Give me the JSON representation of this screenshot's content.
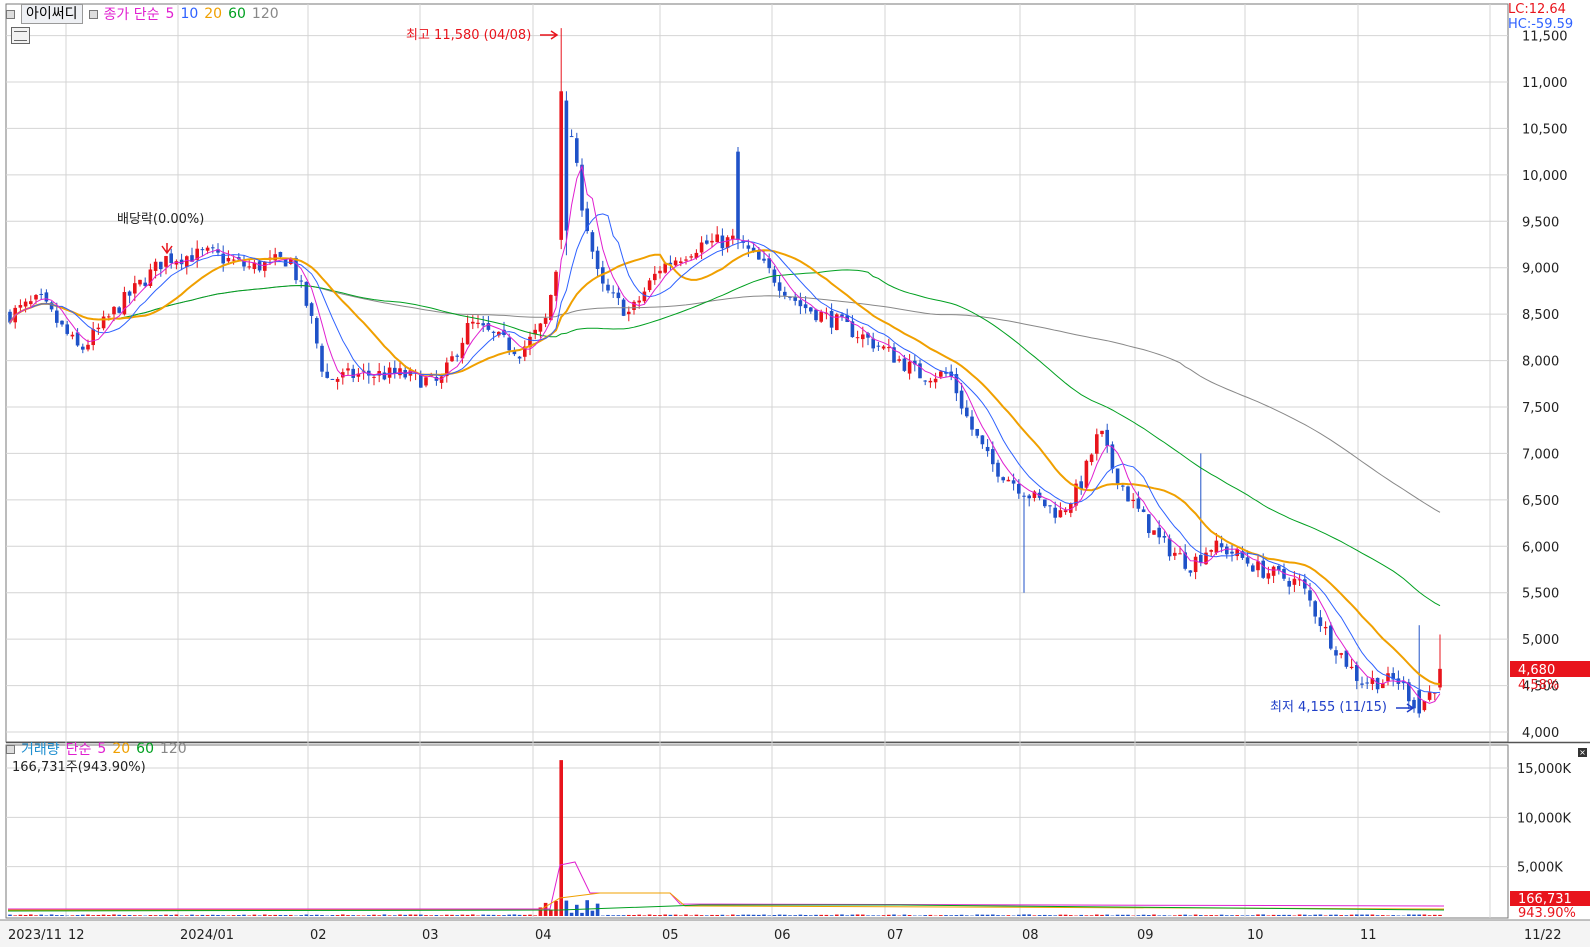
{
  "header": {
    "button_label": "아이써디",
    "price_ma_label": "종가 단순",
    "ma_periods": [
      "5",
      "10",
      "20",
      "60",
      "120"
    ],
    "ma_colors": [
      "#e020d0",
      "#2f62ff",
      "#f0a000",
      "#00a020",
      "#888888"
    ]
  },
  "corner": {
    "lc": "LC:12.64",
    "hc": "HC:-59.59"
  },
  "annotations": {
    "high": "최고 11,580 (04/08)",
    "low": "최저 4,155 (11/15)",
    "dividend": "배당락(0.00%)"
  },
  "current": {
    "price": "4,680",
    "pct": "4.58%",
    "volume": "166,731",
    "volume_pct": "943.90%"
  },
  "volume_header": {
    "label": "거래량",
    "ma_label": "단순",
    "periods": [
      "5",
      "20",
      "60",
      "120"
    ],
    "info": "166,731주(943.90%)"
  },
  "chart_data": {
    "type": "candlestick",
    "price_axis": {
      "ticks": [
        "11,500",
        "11,000",
        "10,500",
        "10,000",
        "9,500",
        "9,000",
        "8,500",
        "8,000",
        "7,500",
        "7,000",
        "6,500",
        "6,000",
        "5,500",
        "5,000",
        "4,500",
        "4,000"
      ],
      "ylim": [
        4000,
        11500
      ]
    },
    "volume_axis": {
      "ticks": [
        "15,000K",
        "10,000K",
        "5,000K"
      ],
      "ylim": [
        0,
        15000
      ]
    },
    "x_labels": [
      "2023/11",
      "12",
      "2024/01",
      "02",
      "03",
      "04",
      "05",
      "06",
      "07",
      "08",
      "09",
      "10",
      "11",
      "11/22"
    ],
    "high": {
      "value": 11580,
      "date": "04/08"
    },
    "low": {
      "value": 4155,
      "date": "11/15"
    },
    "last_close": 4680,
    "colors": {
      "up": "#e8141c",
      "down": "#1f52c8",
      "ma5": "#e020d0",
      "ma10": "#2f62ff",
      "ma20": "#f0a000",
      "ma60": "#00a020",
      "ma120": "#888888"
    }
  }
}
